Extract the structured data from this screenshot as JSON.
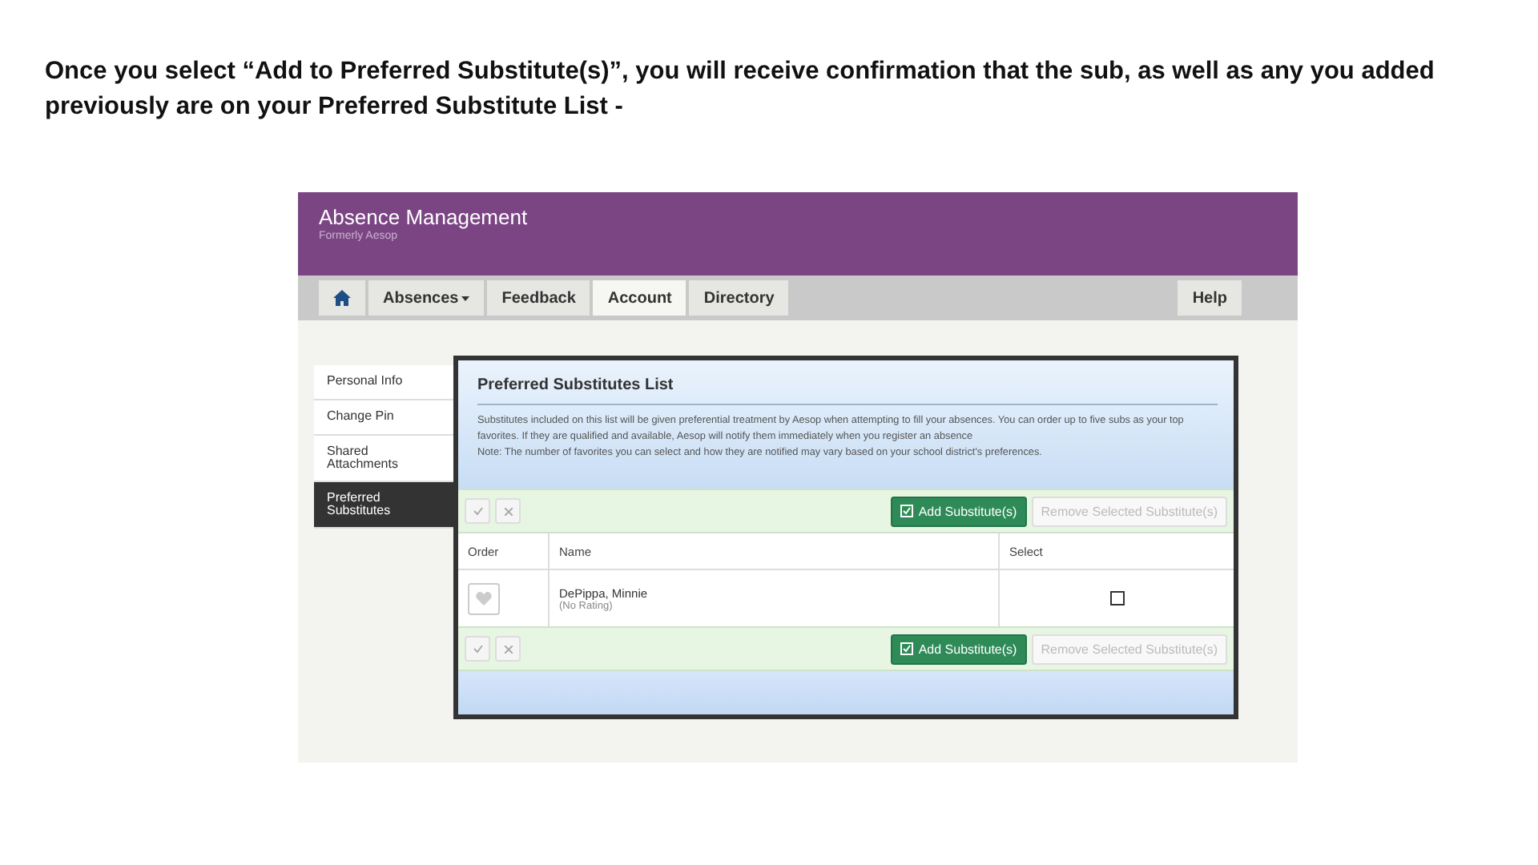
{
  "caption": "Once you select “Add to Preferred Substitute(s)”, you will receive confirmation that the sub, as well as any you added previously are on your Preferred Substitute List -",
  "app": {
    "title": "Absence Management",
    "subtitle": "Formerly Aesop"
  },
  "nav": {
    "tabs": [
      {
        "kind": "home",
        "selected": false
      },
      {
        "kind": "dropdown",
        "label": "Absences",
        "selected": false
      },
      {
        "kind": "plain",
        "label": "Feedback",
        "selected": false
      },
      {
        "kind": "plain",
        "label": "Account",
        "selected": true
      },
      {
        "kind": "plain",
        "label": "Directory",
        "selected": false
      }
    ],
    "help": "Help"
  },
  "sidebar": {
    "items": [
      {
        "label": "Personal Info",
        "selected": false
      },
      {
        "label": "Change Pin",
        "selected": false
      },
      {
        "label": "Shared Attachments",
        "selected": false
      },
      {
        "label": "Preferred Substitutes",
        "selected": true
      }
    ]
  },
  "panel": {
    "title": "Preferred Substitutes List",
    "description": "Substitutes included on this list will be given preferential treatment by Aesop when attempting to fill your absences. You can order up to five subs as your top favorites. If they are qualified and available, Aesop will notify them immediately when you register an absence",
    "note": "Note: The number of favorites you can select and how they are notified may vary based on your school district's preferences.",
    "toolbars": [
      {
        "add": "Add Substitute(s)",
        "remove": "Remove Selected Substitute(s)"
      },
      {
        "add": "Add Substitute(s)",
        "remove": "Remove Selected Substitute(s)"
      }
    ],
    "table": {
      "columns": [
        "Order",
        "Name",
        "Select"
      ],
      "rows": [
        {
          "name": "DePippa, Minnie",
          "rating": "(No Rating)",
          "checked": false
        }
      ]
    }
  }
}
